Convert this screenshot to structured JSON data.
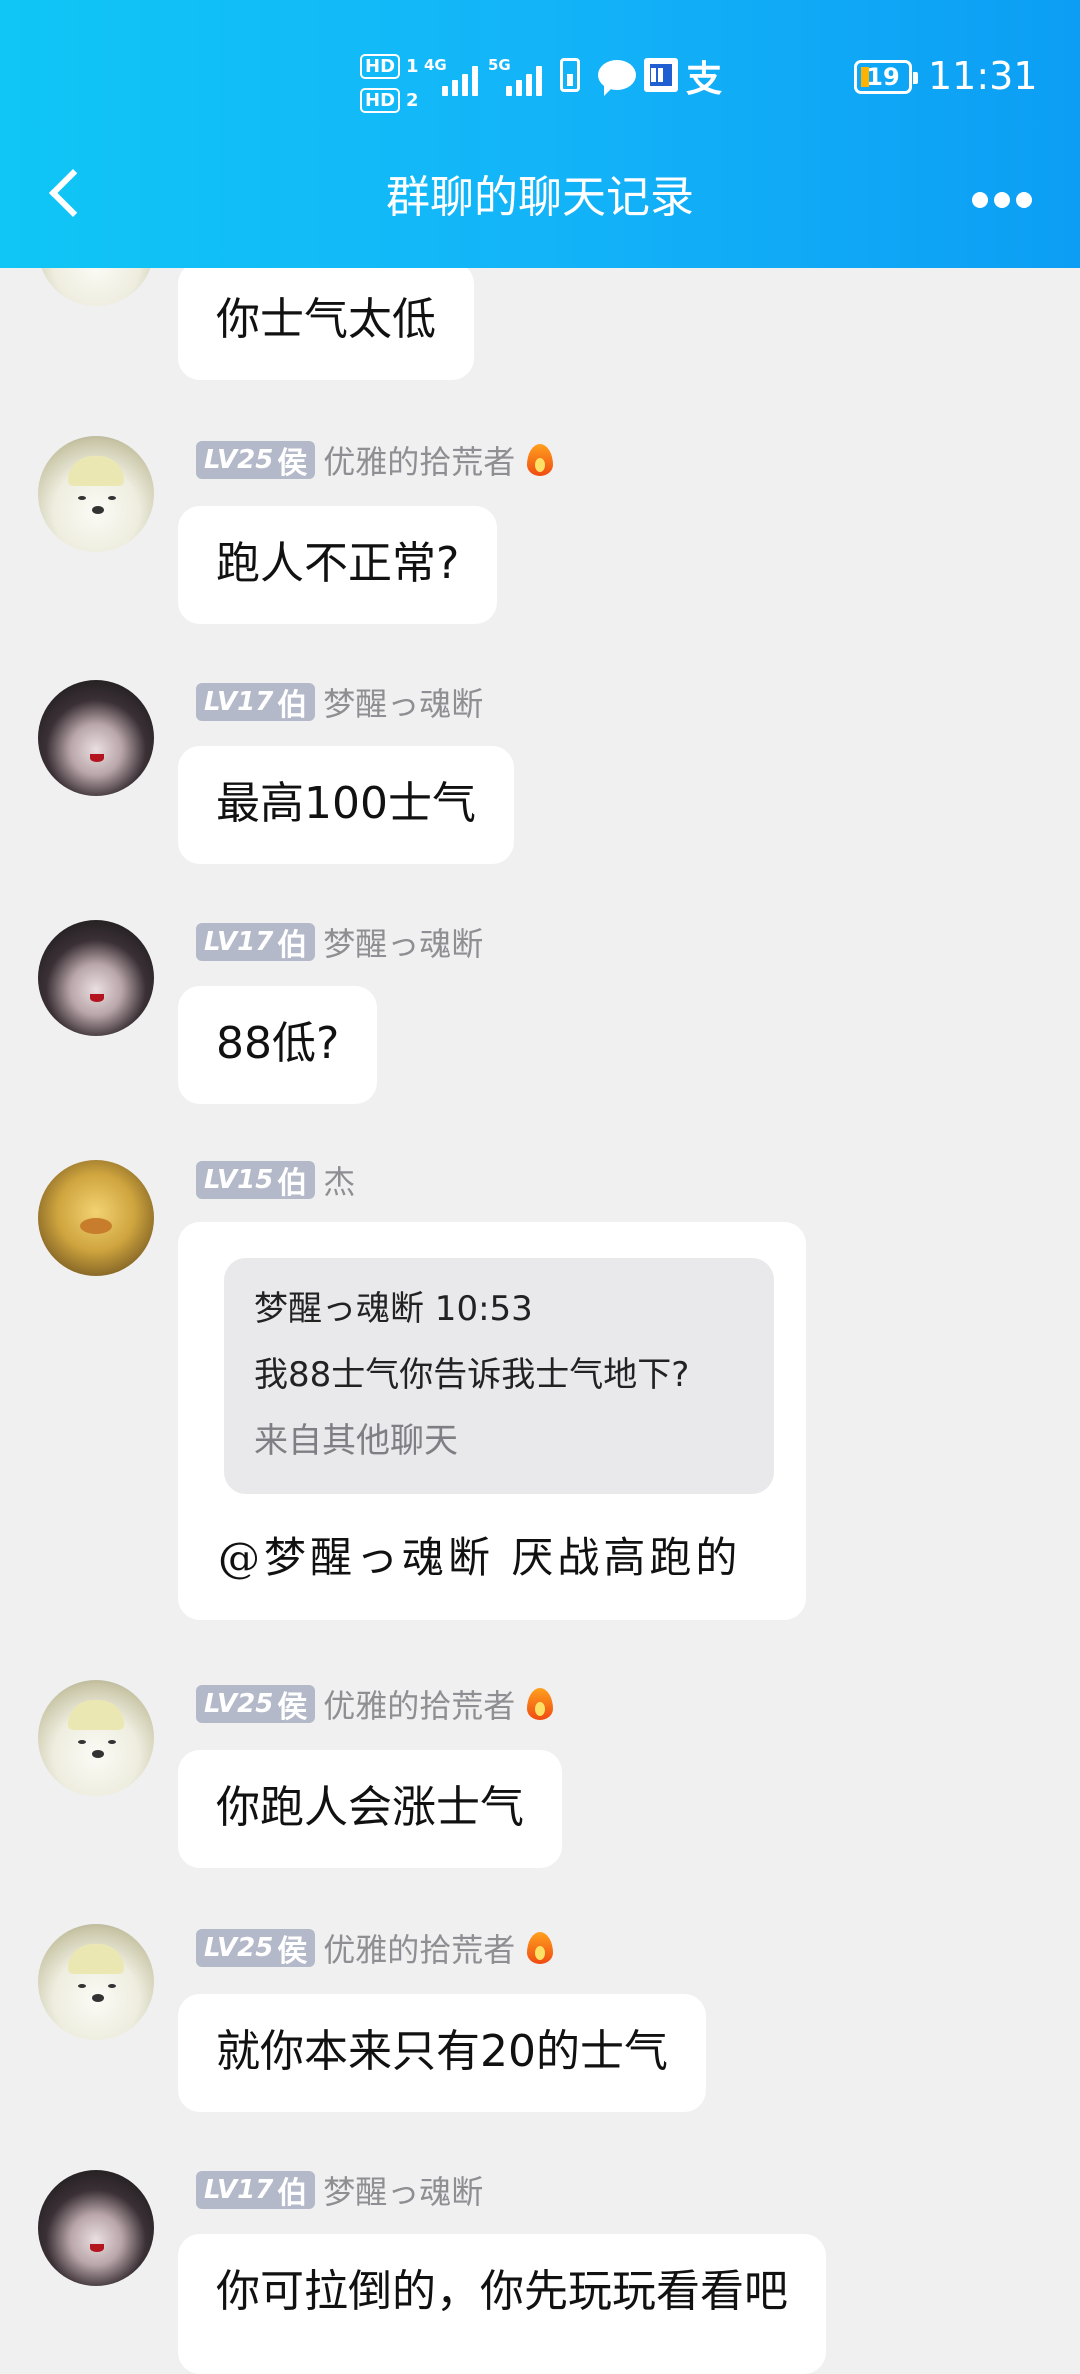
{
  "status_bar": {
    "sim1": "HD",
    "sim1_slot": "1",
    "sim2": "HD",
    "sim2_slot": "2",
    "net1": "4G",
    "net2": "5G",
    "alipay_glyph": "支",
    "battery": "19",
    "time": "11:31"
  },
  "header": {
    "title": "群聊的聊天记录"
  },
  "messages": [
    {
      "text": "你士气太低"
    },
    {
      "level": "LV25",
      "rank": "侯",
      "name": "优雅的拾荒者",
      "text": "跑人不正常?"
    },
    {
      "level": "LV17",
      "rank": "伯",
      "name": "梦醒っ魂断",
      "text": "最高100士气"
    },
    {
      "level": "LV17",
      "rank": "伯",
      "name": "梦醒っ魂断",
      "text": "88低?"
    },
    {
      "level": "LV15",
      "rank": "伯",
      "name": "杰",
      "quote": {
        "sender_time": "梦醒っ魂断 10:53",
        "text": "我88士气你告诉我士气地下?",
        "source": "来自其他聊天"
      },
      "text": "@梦醒っ魂断 厌战高跑的"
    },
    {
      "level": "LV25",
      "rank": "侯",
      "name": "优雅的拾荒者",
      "text": "你跑人会涨士气"
    },
    {
      "level": "LV25",
      "rank": "侯",
      "name": "优雅的拾荒者",
      "text": "就你本来只有20的士气"
    },
    {
      "level": "LV17",
      "rank": "伯",
      "name": "梦醒っ魂断",
      "text": "你可拉倒的，你先玩玩看看吧"
    }
  ],
  "icons": {
    "back": "chevron-left-icon",
    "more": "more-horizontal-icon",
    "flame": "flame-icon"
  }
}
